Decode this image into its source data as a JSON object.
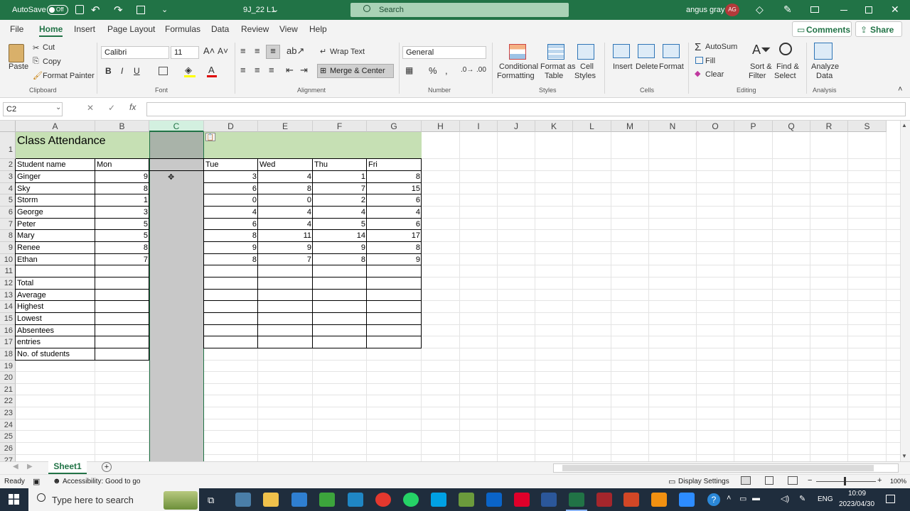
{
  "titlebar": {
    "autosave_label": "AutoSave",
    "autosave_state": "Off",
    "filename": "9J_22 L1",
    "search_placeholder": "Search",
    "user_name": "angus gray",
    "user_initials": "AG"
  },
  "tabs": [
    "File",
    "Home",
    "Insert",
    "Page Layout",
    "Formulas",
    "Data",
    "Review",
    "View",
    "Help"
  ],
  "actions": {
    "comments": "Comments",
    "share": "Share"
  },
  "ribbon": {
    "clipboard": {
      "paste": "Paste",
      "cut": "Cut",
      "copy": "Copy",
      "format_painter": "Format Painter",
      "group": "Clipboard"
    },
    "font": {
      "name": "Calibri",
      "size": "11",
      "group": "Font",
      "bold": "B",
      "italic": "I",
      "underline": "U"
    },
    "alignment": {
      "wrap_text": "Wrap Text",
      "merge_center": "Merge & Center",
      "group": "Alignment"
    },
    "number": {
      "format": "General",
      "group": "Number"
    },
    "styles": {
      "conditional1": "Conditional",
      "conditional2": "Formatting",
      "format_table1": "Format as",
      "format_table2": "Table",
      "cell_styles1": "Cell",
      "cell_styles2": "Styles",
      "group": "Styles"
    },
    "cells": {
      "insert": "Insert",
      "delete": "Delete",
      "format": "Format",
      "group": "Cells"
    },
    "editing": {
      "autosum": "AutoSum",
      "fill": "Fill",
      "clear": "Clear",
      "sort1": "Sort &",
      "sort2": "Filter",
      "find1": "Find &",
      "find2": "Select",
      "group": "Editing"
    },
    "analysis": {
      "analyze1": "Analyze",
      "analyze2": "Data",
      "group": "Analysis"
    }
  },
  "formula_bar": {
    "name_box": "C2",
    "fx": "fx",
    "cancel": "✕",
    "enter": "✓",
    "formula": ""
  },
  "columns": [
    "A",
    "B",
    "C",
    "D",
    "E",
    "F",
    "G",
    "H",
    "I",
    "J",
    "K",
    "L",
    "M",
    "N",
    "O",
    "P",
    "Q",
    "R",
    "S"
  ],
  "rows": [
    "1",
    "2",
    "3",
    "4",
    "5",
    "6",
    "7",
    "8",
    "9",
    "10",
    "11",
    "12",
    "13",
    "14",
    "15",
    "16",
    "17",
    "18",
    "19",
    "20",
    "21",
    "22",
    "23",
    "24",
    "25",
    "26",
    "27"
  ],
  "sheet": {
    "title": "Class Attendance",
    "headers": {
      "name": "Student name",
      "mon": "Mon",
      "tue": "Tue",
      "wed": "Wed",
      "thu": "Thu",
      "fri": "Fri"
    },
    "students": [
      {
        "name": "Ginger",
        "mon": "9",
        "tue": "3",
        "wed": "4",
        "thu": "1",
        "fri": "8"
      },
      {
        "name": "Sky",
        "mon": "8",
        "tue": "6",
        "wed": "8",
        "thu": "7",
        "fri": "15"
      },
      {
        "name": "Storm",
        "mon": "1",
        "tue": "0",
        "wed": "0",
        "thu": "2",
        "fri": "6"
      },
      {
        "name": "George",
        "mon": "3",
        "tue": "4",
        "wed": "4",
        "thu": "4",
        "fri": "4"
      },
      {
        "name": "Peter",
        "mon": "5",
        "tue": "6",
        "wed": "4",
        "thu": "5",
        "fri": "6"
      },
      {
        "name": "Mary",
        "mon": "5",
        "tue": "8",
        "wed": "11",
        "thu": "14",
        "fri": "17"
      },
      {
        "name": "Renee",
        "mon": "8",
        "tue": "9",
        "wed": "9",
        "thu": "9",
        "fri": "8"
      },
      {
        "name": "Ethan",
        "mon": "7",
        "tue": "8",
        "wed": "7",
        "thu": "8",
        "fri": "9"
      }
    ],
    "summary_labels": [
      "Total",
      "Average",
      "Highest",
      "Lowest",
      "Absentees",
      "entries",
      "No. of students"
    ]
  },
  "sheet_tabs": {
    "active": "Sheet1",
    "add": "+"
  },
  "status": {
    "ready": "Ready",
    "accessibility": "Accessibility: Good to go",
    "display_settings": "Display Settings",
    "zoom": "100%"
  },
  "taskbar": {
    "search_placeholder": "Type here to search",
    "lang": "ENG",
    "time": "10:09",
    "date": "2023/04/30"
  },
  "colors": {
    "excel_green": "#217346",
    "title_fill": "#c6e0b4",
    "selected_col": "#c8c8c8"
  }
}
